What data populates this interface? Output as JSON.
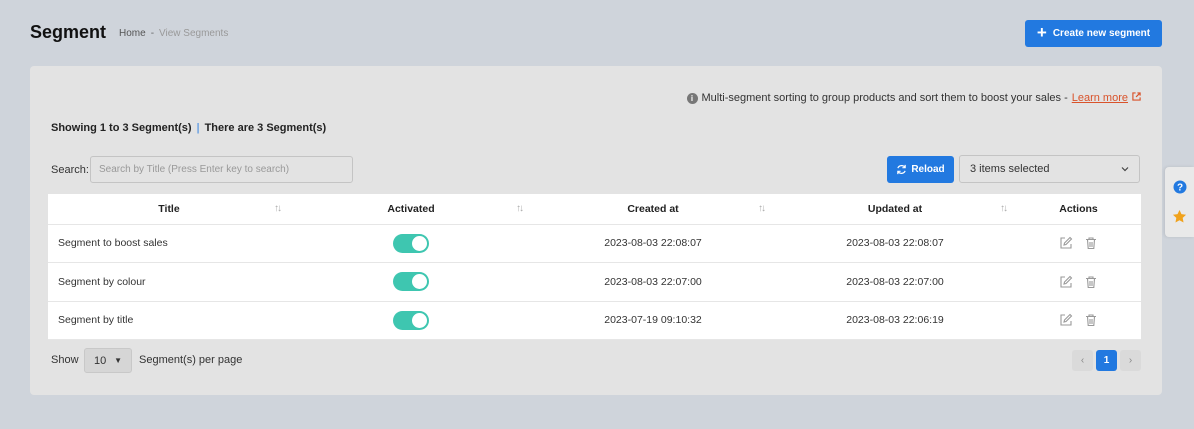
{
  "header": {
    "title": "Segment",
    "breadcrumb": {
      "home": "Home",
      "separator": "-",
      "current": "View Segments"
    },
    "create_button": "Create new segment"
  },
  "info": {
    "text": "Multi-segment sorting to group products and sort them to boost your sales -",
    "link": "Learn more"
  },
  "summary": {
    "showing": "Showing 1 to 3 Segment(s)",
    "separator": "|",
    "total": "There are 3 Segment(s)"
  },
  "search": {
    "label": "Search:",
    "placeholder": "Search by Title (Press Enter key to search)"
  },
  "reload_button": "Reload",
  "columns_select": "3 items selected",
  "table": {
    "headers": [
      "Title",
      "Activated",
      "Created at",
      "Updated at",
      "Actions"
    ],
    "rows": [
      {
        "title": "Segment to boost sales",
        "activated": true,
        "created": "2023-08-03 22:08:07",
        "updated": "2023-08-03 22:08:07"
      },
      {
        "title": "Segment by colour",
        "activated": true,
        "created": "2023-08-03 22:07:00",
        "updated": "2023-08-03 22:07:00"
      },
      {
        "title": "Segment by title",
        "activated": true,
        "created": "2023-07-19 09:10:32",
        "updated": "2023-08-03 22:06:19"
      }
    ]
  },
  "pagination": {
    "show_label": "Show",
    "per_page": "10",
    "per_page_label": "Segment(s) per page",
    "prev": "‹",
    "current": "1",
    "next": "›"
  },
  "colors": {
    "primary": "#2279e0",
    "toggle_on": "#3ec6b0",
    "link": "#d9532b",
    "star": "#f0a21c"
  }
}
